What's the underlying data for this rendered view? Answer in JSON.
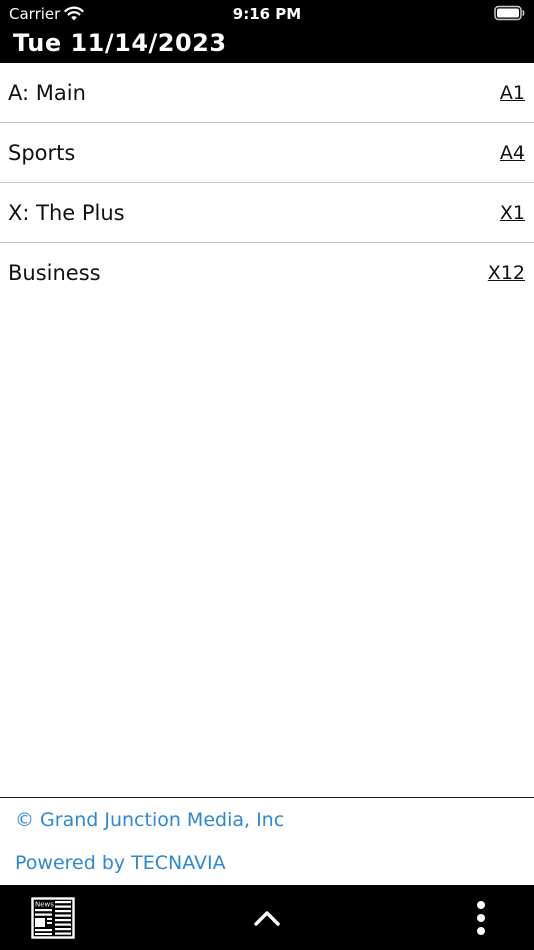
{
  "status_bar": {
    "carrier": "Carrier",
    "time": "9:16 PM"
  },
  "header": {
    "date": "Tue 11/14/2023"
  },
  "sections": [
    {
      "name": "A: Main",
      "page": "A1"
    },
    {
      "name": "Sports",
      "page": "A4"
    },
    {
      "name": "X: The Plus",
      "page": "X1"
    },
    {
      "name": "Business",
      "page": "X12"
    }
  ],
  "footer": {
    "copyright": "© Grand Junction Media, Inc",
    "powered_by": "Powered by TECNAVIA"
  },
  "toolbar": {
    "news_icon_label": "News",
    "icons": [
      "newspaper-icon",
      "chevron-up-icon",
      "more-vertical-icon"
    ]
  },
  "colors": {
    "header_bg": "#000000",
    "toolbar_bg": "#000000",
    "link_blue": "#2f88d0",
    "row_divider": "#c8c8c8"
  }
}
